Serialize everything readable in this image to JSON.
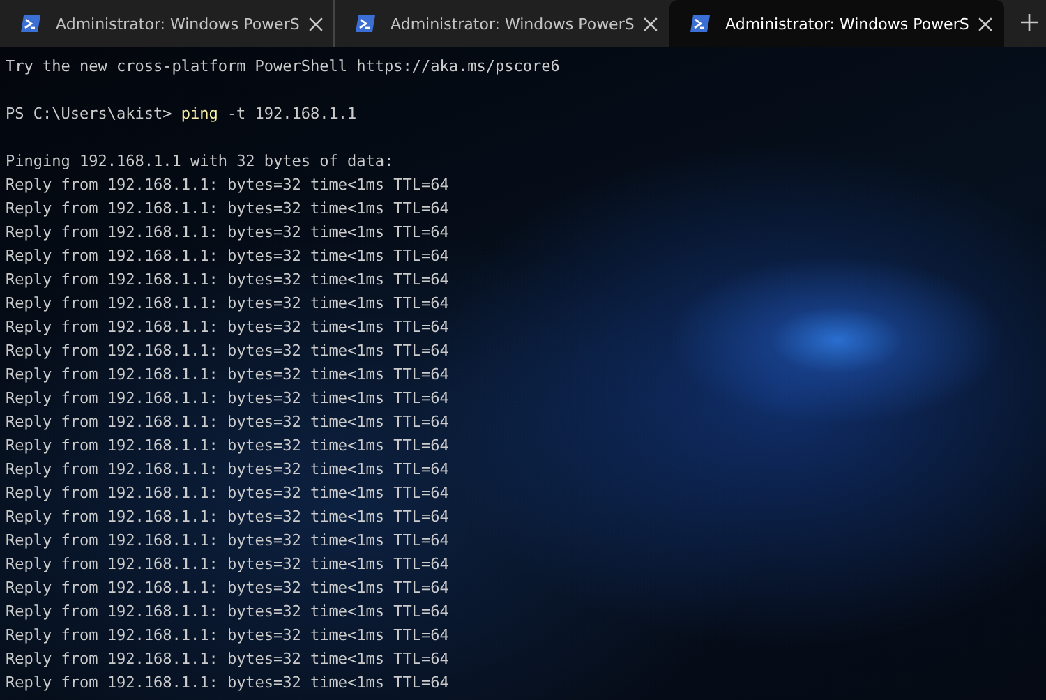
{
  "tabs": [
    {
      "title": "Administrator: Windows PowerS",
      "selected": false
    },
    {
      "title": "Administrator: Windows PowerS",
      "selected": false
    },
    {
      "title": "Administrator: Windows PowerS",
      "selected": true
    }
  ],
  "terminal": {
    "lines": [
      {
        "kind": "output",
        "text": "Try the new cross-platform PowerShell https://aka.ms/pscore6"
      },
      {
        "kind": "blank"
      },
      {
        "kind": "prompt",
        "prompt": "PS C:\\Users\\akist>",
        "command": "ping",
        "args": "-t 192.168.1.1"
      },
      {
        "kind": "blank"
      },
      {
        "kind": "output",
        "text": "Pinging 192.168.1.1 with 32 bytes of data:"
      },
      {
        "kind": "output",
        "text": "Reply from 192.168.1.1: bytes=32 time<1ms TTL=64"
      },
      {
        "kind": "output",
        "text": "Reply from 192.168.1.1: bytes=32 time<1ms TTL=64"
      },
      {
        "kind": "output",
        "text": "Reply from 192.168.1.1: bytes=32 time<1ms TTL=64"
      },
      {
        "kind": "output",
        "text": "Reply from 192.168.1.1: bytes=32 time<1ms TTL=64"
      },
      {
        "kind": "output",
        "text": "Reply from 192.168.1.1: bytes=32 time<1ms TTL=64"
      },
      {
        "kind": "output",
        "text": "Reply from 192.168.1.1: bytes=32 time<1ms TTL=64"
      },
      {
        "kind": "output",
        "text": "Reply from 192.168.1.1: bytes=32 time<1ms TTL=64"
      },
      {
        "kind": "output",
        "text": "Reply from 192.168.1.1: bytes=32 time<1ms TTL=64"
      },
      {
        "kind": "output",
        "text": "Reply from 192.168.1.1: bytes=32 time<1ms TTL=64"
      },
      {
        "kind": "output",
        "text": "Reply from 192.168.1.1: bytes=32 time<1ms TTL=64"
      },
      {
        "kind": "output",
        "text": "Reply from 192.168.1.1: bytes=32 time<1ms TTL=64"
      },
      {
        "kind": "output",
        "text": "Reply from 192.168.1.1: bytes=32 time<1ms TTL=64"
      },
      {
        "kind": "output",
        "text": "Reply from 192.168.1.1: bytes=32 time<1ms TTL=64"
      },
      {
        "kind": "output",
        "text": "Reply from 192.168.1.1: bytes=32 time<1ms TTL=64"
      },
      {
        "kind": "output",
        "text": "Reply from 192.168.1.1: bytes=32 time<1ms TTL=64"
      },
      {
        "kind": "output",
        "text": "Reply from 192.168.1.1: bytes=32 time<1ms TTL=64"
      },
      {
        "kind": "output",
        "text": "Reply from 192.168.1.1: bytes=32 time<1ms TTL=64"
      },
      {
        "kind": "output",
        "text": "Reply from 192.168.1.1: bytes=32 time<1ms TTL=64"
      },
      {
        "kind": "output",
        "text": "Reply from 192.168.1.1: bytes=32 time<1ms TTL=64"
      },
      {
        "kind": "output",
        "text": "Reply from 192.168.1.1: bytes=32 time<1ms TTL=64"
      },
      {
        "kind": "output",
        "text": "Reply from 192.168.1.1: bytes=32 time<1ms TTL=64"
      },
      {
        "kind": "output",
        "text": "Reply from 192.168.1.1: bytes=32 time<1ms TTL=64"
      }
    ]
  }
}
